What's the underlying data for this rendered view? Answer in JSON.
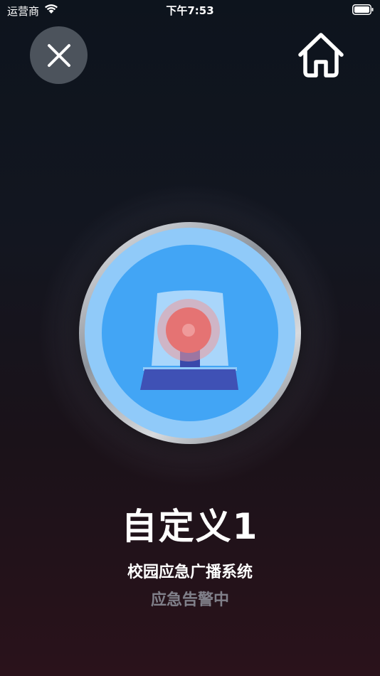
{
  "status_bar": {
    "carrier": "运营商",
    "time": "下午7:53"
  },
  "header": {
    "close_icon": "close-icon",
    "home_icon": "home-icon"
  },
  "alarm": {
    "icon": "siren-icon",
    "colors": {
      "outer_ring": "#90caf9",
      "inner_disc": "#42a5f5",
      "light": "#e57373",
      "base": "#3f51b5"
    }
  },
  "main": {
    "title": "自定义1",
    "subtitle": "校园应急广播系统",
    "status": "应急告警中"
  }
}
